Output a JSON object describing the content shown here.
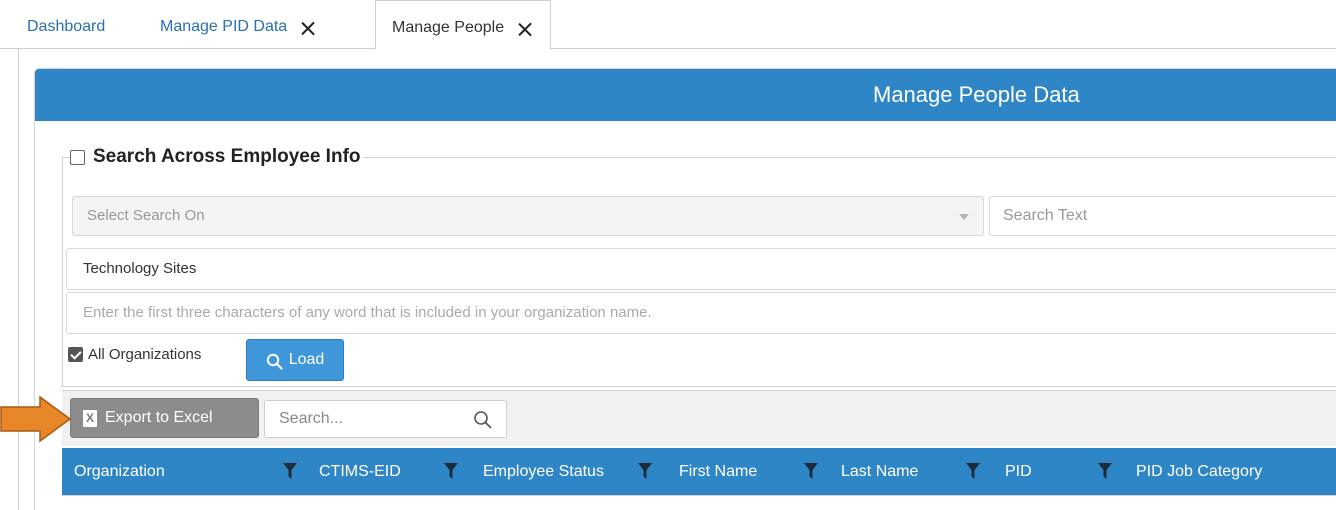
{
  "tabs": [
    {
      "label": "Dashboard",
      "closable": false,
      "active": false
    },
    {
      "label": "Manage PID Data",
      "closable": true,
      "active": false
    },
    {
      "label": "Manage People",
      "closable": true,
      "active": true
    }
  ],
  "panel": {
    "title": "Manage People Data"
  },
  "search": {
    "legend": "Search Across Employee Info",
    "legend_checked": false,
    "select_placeholder": "Select Search On",
    "text_placeholder": "Search Text",
    "organization_value": "Technology Sites",
    "organization_hint": "Enter the first three characters of any word that is included in your organization name.",
    "all_orgs_label": "All Organizations",
    "all_orgs_checked": true,
    "load_label": "Load"
  },
  "toolbar": {
    "export_label": "Export to Excel",
    "export_icon": "excel-file-icon",
    "search_placeholder": "Search..."
  },
  "grid": {
    "columns": [
      "Organization",
      "CTIMS-EID",
      "Employee Status",
      "First Name",
      "Last Name",
      "PID",
      "PID Job Category"
    ]
  },
  "colors": {
    "accent": "#2f86c6",
    "load_button": "#3f96d8",
    "export_button": "#8c8c8c",
    "arrow": "#e8862a"
  }
}
